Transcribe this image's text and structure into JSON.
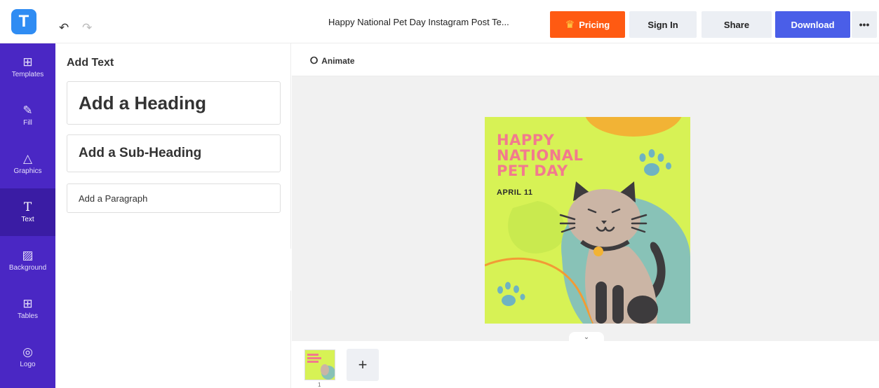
{
  "topbar": {
    "logo_letter": "T",
    "undo_icon": "undo-icon",
    "redo_icon": "redo-icon",
    "document_title": "Happy National Pet Day Instagram Post Te...",
    "pricing_label": "Pricing",
    "signin_label": "Sign In",
    "share_label": "Share",
    "download_label": "Download",
    "more_label": "•••",
    "accent_pricing": "#ff5a12",
    "accent_download": "#4a5ee8"
  },
  "sidebar": {
    "color": "#4a27c4",
    "items": [
      {
        "label": "Templates",
        "icon": "templates-icon"
      },
      {
        "label": "Fill",
        "icon": "pencil-icon"
      },
      {
        "label": "Graphics",
        "icon": "shapes-icon"
      },
      {
        "label": "Text",
        "icon": "text-icon"
      },
      {
        "label": "Background",
        "icon": "background-icon"
      },
      {
        "label": "Tables",
        "icon": "table-icon"
      },
      {
        "label": "Logo",
        "icon": "logo-icon"
      }
    ],
    "active": "Text"
  },
  "text_panel": {
    "title": "Add Text",
    "heading_label": "Add a Heading",
    "subheading_label": "Add a Sub-Heading",
    "paragraph_label": "Add a Paragraph"
  },
  "editor": {
    "animate_label": "Animate",
    "add_page_label": "+",
    "page_number": "1"
  },
  "design": {
    "title_lines": [
      "HAPPY",
      "NATIONAL",
      "PET DAY"
    ],
    "date": "APRIL 11",
    "background_color": "#d7f255",
    "title_color": "#f27a8e"
  }
}
